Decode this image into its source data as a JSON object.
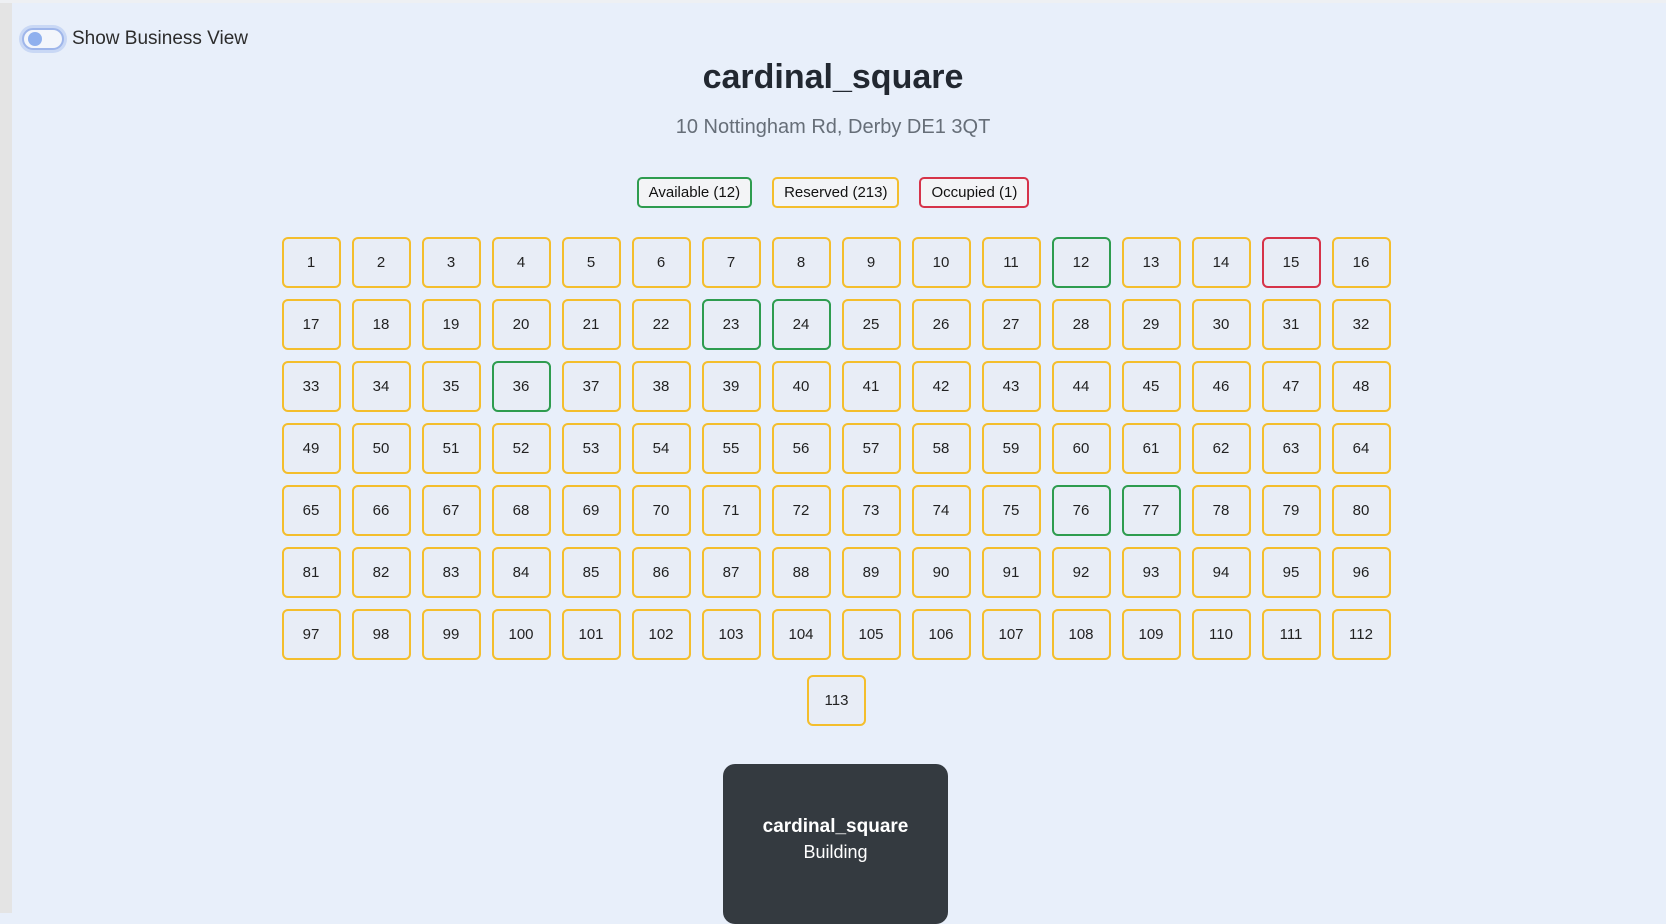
{
  "toggle": {
    "label": "Show Business View",
    "checked": false
  },
  "building": {
    "name": "cardinal_square",
    "address": "10 Nottingham Rd, Derby DE1 3QT",
    "type": "Building"
  },
  "legend": {
    "available": "Available (12)",
    "reserved": "Reserved (213)",
    "occupied": "Occupied (1)"
  },
  "colors": {
    "available": "#2e9c4f",
    "reserved": "#f4be2c",
    "occupied": "#d63349"
  },
  "units": [
    {
      "n": "1",
      "s": "reserved"
    },
    {
      "n": "2",
      "s": "reserved"
    },
    {
      "n": "3",
      "s": "reserved"
    },
    {
      "n": "4",
      "s": "reserved"
    },
    {
      "n": "5",
      "s": "reserved"
    },
    {
      "n": "6",
      "s": "reserved"
    },
    {
      "n": "7",
      "s": "reserved"
    },
    {
      "n": "8",
      "s": "reserved"
    },
    {
      "n": "9",
      "s": "reserved"
    },
    {
      "n": "10",
      "s": "reserved"
    },
    {
      "n": "11",
      "s": "reserved"
    },
    {
      "n": "12",
      "s": "available"
    },
    {
      "n": "13",
      "s": "reserved"
    },
    {
      "n": "14",
      "s": "reserved"
    },
    {
      "n": "15",
      "s": "occupied"
    },
    {
      "n": "16",
      "s": "reserved"
    },
    {
      "n": "17",
      "s": "reserved"
    },
    {
      "n": "18",
      "s": "reserved"
    },
    {
      "n": "19",
      "s": "reserved"
    },
    {
      "n": "20",
      "s": "reserved"
    },
    {
      "n": "21",
      "s": "reserved"
    },
    {
      "n": "22",
      "s": "reserved"
    },
    {
      "n": "23",
      "s": "available"
    },
    {
      "n": "24",
      "s": "available"
    },
    {
      "n": "25",
      "s": "reserved"
    },
    {
      "n": "26",
      "s": "reserved"
    },
    {
      "n": "27",
      "s": "reserved"
    },
    {
      "n": "28",
      "s": "reserved"
    },
    {
      "n": "29",
      "s": "reserved"
    },
    {
      "n": "30",
      "s": "reserved"
    },
    {
      "n": "31",
      "s": "reserved"
    },
    {
      "n": "32",
      "s": "reserved"
    },
    {
      "n": "33",
      "s": "reserved"
    },
    {
      "n": "34",
      "s": "reserved"
    },
    {
      "n": "35",
      "s": "reserved"
    },
    {
      "n": "36",
      "s": "available"
    },
    {
      "n": "37",
      "s": "reserved"
    },
    {
      "n": "38",
      "s": "reserved"
    },
    {
      "n": "39",
      "s": "reserved"
    },
    {
      "n": "40",
      "s": "reserved"
    },
    {
      "n": "41",
      "s": "reserved"
    },
    {
      "n": "42",
      "s": "reserved"
    },
    {
      "n": "43",
      "s": "reserved"
    },
    {
      "n": "44",
      "s": "reserved"
    },
    {
      "n": "45",
      "s": "reserved"
    },
    {
      "n": "46",
      "s": "reserved"
    },
    {
      "n": "47",
      "s": "reserved"
    },
    {
      "n": "48",
      "s": "reserved"
    },
    {
      "n": "49",
      "s": "reserved"
    },
    {
      "n": "50",
      "s": "reserved"
    },
    {
      "n": "51",
      "s": "reserved"
    },
    {
      "n": "52",
      "s": "reserved"
    },
    {
      "n": "53",
      "s": "reserved"
    },
    {
      "n": "54",
      "s": "reserved"
    },
    {
      "n": "55",
      "s": "reserved"
    },
    {
      "n": "56",
      "s": "reserved"
    },
    {
      "n": "57",
      "s": "reserved"
    },
    {
      "n": "58",
      "s": "reserved"
    },
    {
      "n": "59",
      "s": "reserved"
    },
    {
      "n": "60",
      "s": "reserved"
    },
    {
      "n": "61",
      "s": "reserved"
    },
    {
      "n": "62",
      "s": "reserved"
    },
    {
      "n": "63",
      "s": "reserved"
    },
    {
      "n": "64",
      "s": "reserved"
    },
    {
      "n": "65",
      "s": "reserved"
    },
    {
      "n": "66",
      "s": "reserved"
    },
    {
      "n": "67",
      "s": "reserved"
    },
    {
      "n": "68",
      "s": "reserved"
    },
    {
      "n": "69",
      "s": "reserved"
    },
    {
      "n": "70",
      "s": "reserved"
    },
    {
      "n": "71",
      "s": "reserved"
    },
    {
      "n": "72",
      "s": "reserved"
    },
    {
      "n": "73",
      "s": "reserved"
    },
    {
      "n": "74",
      "s": "reserved"
    },
    {
      "n": "75",
      "s": "reserved"
    },
    {
      "n": "76",
      "s": "available"
    },
    {
      "n": "77",
      "s": "available"
    },
    {
      "n": "78",
      "s": "reserved"
    },
    {
      "n": "79",
      "s": "reserved"
    },
    {
      "n": "80",
      "s": "reserved"
    },
    {
      "n": "81",
      "s": "reserved"
    },
    {
      "n": "82",
      "s": "reserved"
    },
    {
      "n": "83",
      "s": "reserved"
    },
    {
      "n": "84",
      "s": "reserved"
    },
    {
      "n": "85",
      "s": "reserved"
    },
    {
      "n": "86",
      "s": "reserved"
    },
    {
      "n": "87",
      "s": "reserved"
    },
    {
      "n": "88",
      "s": "reserved"
    },
    {
      "n": "89",
      "s": "reserved"
    },
    {
      "n": "90",
      "s": "reserved"
    },
    {
      "n": "91",
      "s": "reserved"
    },
    {
      "n": "92",
      "s": "reserved"
    },
    {
      "n": "93",
      "s": "reserved"
    },
    {
      "n": "94",
      "s": "reserved"
    },
    {
      "n": "95",
      "s": "reserved"
    },
    {
      "n": "96",
      "s": "reserved"
    },
    {
      "n": "97",
      "s": "reserved"
    },
    {
      "n": "98",
      "s": "reserved"
    },
    {
      "n": "99",
      "s": "reserved"
    },
    {
      "n": "100",
      "s": "reserved"
    },
    {
      "n": "101",
      "s": "reserved"
    },
    {
      "n": "102",
      "s": "reserved"
    },
    {
      "n": "103",
      "s": "reserved"
    },
    {
      "n": "104",
      "s": "reserved"
    },
    {
      "n": "105",
      "s": "reserved"
    },
    {
      "n": "106",
      "s": "reserved"
    },
    {
      "n": "107",
      "s": "reserved"
    },
    {
      "n": "108",
      "s": "reserved"
    },
    {
      "n": "109",
      "s": "reserved"
    },
    {
      "n": "110",
      "s": "reserved"
    },
    {
      "n": "111",
      "s": "reserved"
    },
    {
      "n": "112",
      "s": "reserved"
    },
    {
      "n": "113",
      "s": "reserved"
    }
  ]
}
